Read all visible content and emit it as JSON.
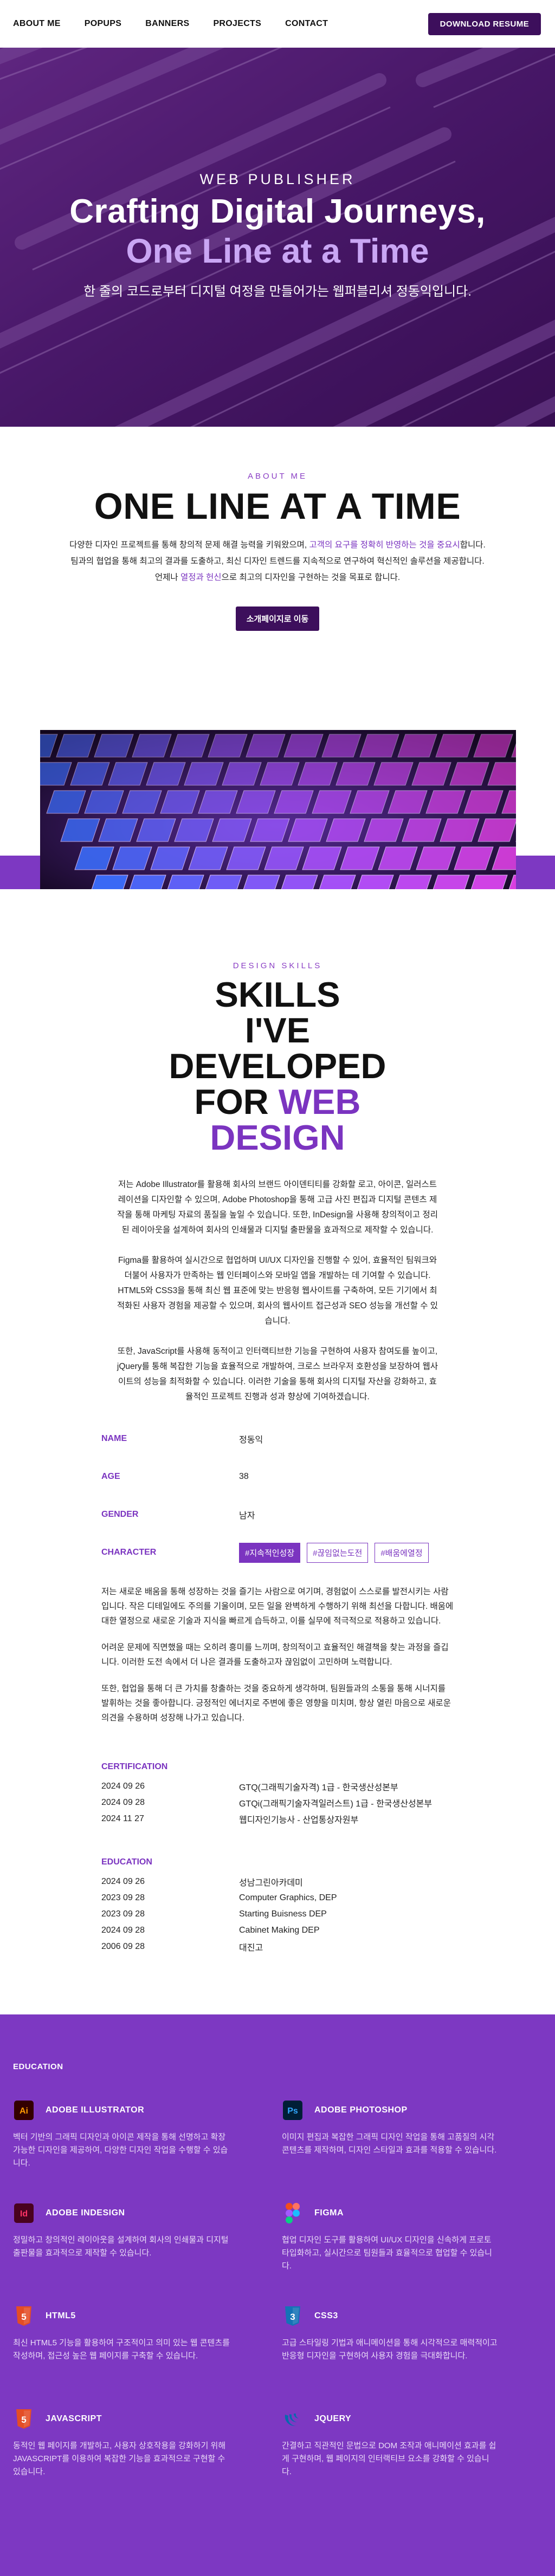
{
  "nav": {
    "links": [
      "ABOUT ME",
      "POPUPS",
      "BANNERS",
      "PROJECTS",
      "CONTACT"
    ],
    "download_label": "DOWNLOAD RESUME"
  },
  "hero": {
    "kicker": "WEB PUBLISHER",
    "title": "Crafting Digital Journeys,",
    "title2": "One Line at a Time",
    "subtitle": "한 줄의 코드로부터 디지털 여정을 만들어가는 웹퍼블리셔 정동익입니다."
  },
  "about": {
    "kicker": "ABOUT ME",
    "title": "ONE LINE AT A TIME",
    "line1_a": "다양한 디자인 프로젝트를 통해 창의적 문제 해결 능력을 키워왔으며, ",
    "line1_hl": "고객의 요구를 정확히 반영하는 것을 중요시",
    "line1_b": "합니다.",
    "line2": "팀과의 협업을 통해 최고의 결과를 도출하고, 최신 디자인 트렌드를 지속적으로 연구하여 혁신적인 솔루션을 제공합니다.",
    "line3_a": "언제나 ",
    "line3_hl": "열정과 헌신",
    "line3_b": "으로 최고의 디자인을 구현하는 것을 목표로 합니다.",
    "button": "소개페이지로 이동"
  },
  "skills": {
    "kicker": "DESIGN SKILLS",
    "title_l1": "SKILLS",
    "title_l2": "I'VE",
    "title_l3": "DEVELOPED",
    "title_l4a": "FOR ",
    "title_l4b": "WEB",
    "title_l5": "DESIGN",
    "paragraphs": [
      "저는 Adobe Illustrator를 활용해 회사의 브랜드 아이덴티티를 강화할 로고, 아이콘, 일러스트레이션을 디자인할 수 있으며, Adobe Photoshop을 통해 고급 사진 편집과 디지털 콘텐츠 제작을 통해 마케팅 자료의 품질을 높일 수 있습니다. 또한, InDesign을 사용해 창의적이고 정리된 레이아웃을 설계하여 회사의 인쇄물과 디지털 출판물을 효과적으로 제작할 수 있습니다.",
      "Figma를 활용하여 실시간으로 협업하며 UI/UX 디자인을 진행할 수 있어, 효율적인 팀워크와 더불어 사용자가 만족하는 웹 인터페이스와 모바일 앱을 개발하는 데 기여할 수 있습니다. HTML5와 CSS3을 통해 최신 웹 표준에 맞는 반응형 웹사이트를 구축하여, 모든 기기에서 최적화된 사용자 경험을 제공할 수 있으며, 회사의 웹사이트 접근성과 SEO 성능을 개선할 수 있습니다.",
      "또한, JavaScript를 사용해 동적이고 인터랙티브한 기능을 구현하여 사용자 참여도를 높이고, jQuery를 통해 복잡한 기능을 효율적으로 개발하여, 크로스 브라우저 호환성을 보장하여 웹사이트의 성능을 최적화할 수 있습니다. 이러한 기술을 통해 회사의 디지털 자산을 강화하고, 효율적인 프로젝트 진행과 성과 향상에 기여하겠습니다."
    ]
  },
  "info": {
    "rows": [
      {
        "label": "NAME",
        "value": "정동익"
      },
      {
        "label": "AGE",
        "value": "38"
      },
      {
        "label": "GENDER",
        "value": "남자"
      }
    ],
    "character_label": "CHARACTER",
    "tags": [
      "#지속적인성장",
      "#끊임없는도전",
      "#배움에열정"
    ],
    "desc": [
      "저는 새로운 배움을 통해 성장하는 것을 즐기는 사람으로 여기며, 경험없이 스스로를 발전시키는 사람입니다. 작은 디테일에도 주의를 기울이며, 모든 일을 완벽하게 수행하기 위해 최선을 다합니다. 배움에 대한 열정으로 새로운 기술과 지식을 빠르게 습득하고, 이를 실무에 적극적으로 적용하고 있습니다.",
      "어려운 문제에 직면했을 때는 오히려 흥미를 느끼며, 창의적이고 효율적인 해결책을 찾는 과정을 즐깁니다. 이러한 도전 속에서 더 나은 결과를 도출하고자 끊임없이 고민하며 노력합니다.",
      "또한, 협업을 통해 더 큰 가치를 창출하는 것을 중요하게 생각하며, 팀원들과의 소통을 통해 시너지를 발휘하는 것을 좋아합니다. 긍정적인 에너지로 주변에 좋은 영향을 미치며, 항상 열린 마음으로 새로운 의견을 수용하며 성장해 나가고 있습니다."
    ]
  },
  "certification": {
    "heading": "CERTIFICATION",
    "items": [
      {
        "date": "2024 09 26",
        "name": "GTQ(그래픽기술자격) 1급 - 한국생산성본부"
      },
      {
        "date": "2024 09 28",
        "name": "GTQi(그래픽기술자격일러스트) 1급 - 한국생산성본부"
      },
      {
        "date": "2024 11 27",
        "name": "웹디자인기능사 - 산업통상자원부"
      }
    ]
  },
  "education": {
    "heading": "EDUCATION",
    "items": [
      {
        "date": "2024 09 26",
        "name": "성남그린아카데미"
      },
      {
        "date": "2023 09 28",
        "name": "Computer Graphics, DEP"
      },
      {
        "date": "2023 09 28",
        "name": "Starting Buisness DEP"
      },
      {
        "date": "2024 09 28",
        "name": "Cabinet Making DEP"
      },
      {
        "date": "2006 09 28",
        "name": "대진고"
      }
    ]
  },
  "tools": {
    "heading": "EDUCATION",
    "cards": [
      {
        "icon": "adobe-illustrator-icon",
        "glyph": "Ai",
        "color": "#330000",
        "fg": "#ff9a00",
        "title": "ADOBE ILLUSTRATOR",
        "text": "벡터 기반의 그래픽 디자인과 아이콘 제작을 통해 선명하고 확장 가능한 디자인을 제공하여, 다양한 디자인 작업을 수행할 수 있습니다."
      },
      {
        "icon": "adobe-photoshop-icon",
        "glyph": "Ps",
        "color": "#001e36",
        "fg": "#31a8ff",
        "title": "ADOBE PHOTOSHOP",
        "text": "이미지 편집과 복잡한 그래픽 디자인 작업을 통해 고품질의 시각 콘텐츠를 제작하며, 디자인 스타일과 효과를 적용할 수 있습니다."
      },
      {
        "icon": "adobe-indesign-icon",
        "glyph": "Id",
        "color": "#49021f",
        "fg": "#ff3366",
        "title": "ADOBE INDESIGN",
        "text": "정밀하고 창의적인 레이아웃을 설계하여 회사의 인쇄물과 디지털 출판물을 효과적으로 제작할 수 있습니다."
      },
      {
        "icon": "figma-icon",
        "glyph": "",
        "color": "",
        "fg": "",
        "title": "FIGMA",
        "text": "협업 디자인 도구를 활용하여 UI/UX 디자인을 신속하게 프로토타입화하고, 실시간으로 팀원들과 효율적으로 협업할 수 있습니다."
      },
      {
        "icon": "html5-icon",
        "glyph": "5",
        "color": "#e44d26",
        "fg": "#ffffff",
        "title": "HTML5",
        "text": "최신 HTML5 기능을 활용하여 구조적이고 의미 있는 웹 콘텐츠를 작성하며, 접근성 높은 웹 페이지를 구축할 수 있습니다."
      },
      {
        "icon": "css3-icon",
        "glyph": "3",
        "color": "#1572b6",
        "fg": "#ffffff",
        "title": "CSS3",
        "text": "고급 스타일링 기법과 애니메이션을 통해 시각적으로 매력적이고 반응형 디자인을 구현하여 사용자 경험을 극대화합니다."
      },
      {
        "icon": "javascript-icon",
        "glyph": "5",
        "color": "#e44d26",
        "fg": "#ffffff",
        "title": "JAVASCRIPT",
        "text": "동적인 웹 페이지를 개발하고, 사용자 상호작용을 강화하기 위해 JAVASCRIPT를 이용하여 복잡한 기능을 효과적으로 구현할 수 있습니다."
      },
      {
        "icon": "jquery-icon",
        "glyph": "",
        "color": "",
        "fg": "",
        "title": "JQUERY",
        "text": "간결하고 직관적인 문법으로 DOM 조작과 애니메이션 효과를 쉽게 구현하며, 웹 페이지의 인터랙티브 요소를 강화할 수 있습니다."
      }
    ]
  }
}
